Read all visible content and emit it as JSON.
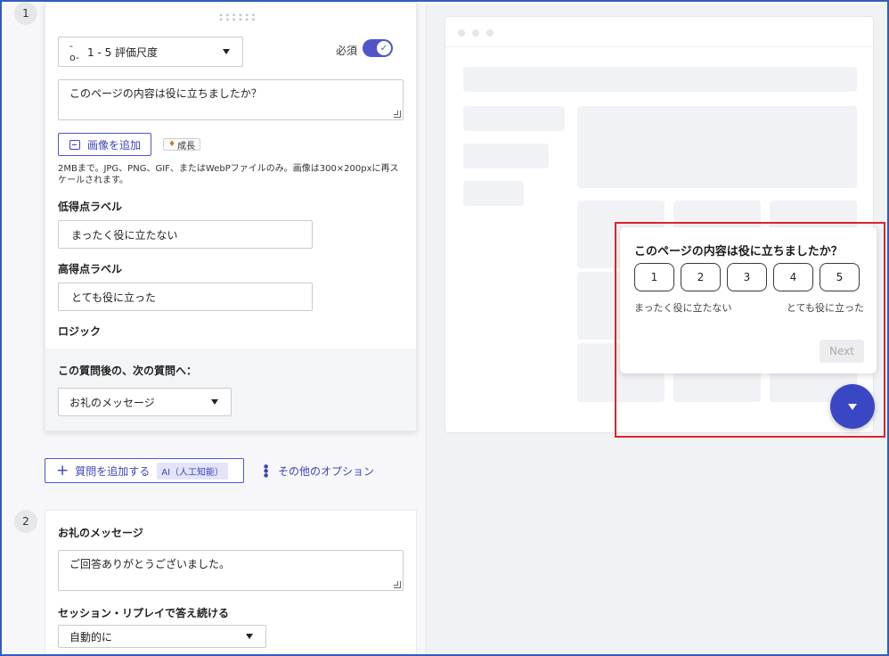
{
  "question1": {
    "number": "1",
    "type_label": "1 - 5 評価尺度",
    "type_icon": "-o-",
    "required_label": "必須",
    "required_check": "✓",
    "question_text": "このページの内容は役に立ちましたか？",
    "add_image_label": "画像を追加",
    "growth_badge_label": "成長",
    "help_text": "2MBまで。JPG、PNG、GIF、またはWebPファイルのみ。画像は300×200pxに再スケールされます。",
    "low_score_label": "低得点ラベル",
    "low_score_value": "まったく役に立たない",
    "high_score_label": "高得点ラベル",
    "high_score_value": "とても役に立った",
    "logic_label": "ロジック",
    "next_question_label": "この質問後の、次の質問へ：",
    "next_question_value": "お礼のメッセージ"
  },
  "actions": {
    "add_question_label": "質問を追加する",
    "ai_badge_label": "AI（人工知能）",
    "more_options_label": "その他のオプション"
  },
  "question2": {
    "number": "2",
    "title": "お礼のメッセージ",
    "message_text": "ご回答ありがとうございました。",
    "session_label": "セッション・リプレイで答え続ける",
    "session_value": "自動的に"
  },
  "preview": {
    "question": "このページの内容は役に立ちましたか？",
    "ratings": [
      "1",
      "2",
      "3",
      "4",
      "5"
    ],
    "low_label": "まったく役に立たない",
    "high_label": "とても役に立った",
    "next_label": "Next"
  },
  "colors": {
    "accent": "#4f56c9",
    "fab": "#3a47c4",
    "highlight_border": "#d9262b"
  }
}
